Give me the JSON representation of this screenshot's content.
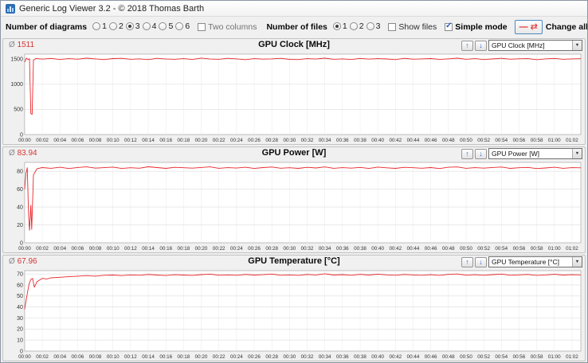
{
  "window": {
    "title": "Generic Log Viewer 3.2 - © 2018 Thomas Barth"
  },
  "icons": {
    "up_arrow": "↑",
    "down_arrow": "↓",
    "swap": "⇄",
    "dash": "—",
    "combo_arrow": "▼",
    "check": "✓"
  },
  "toolbar": {
    "diagrams_label": "Number of diagrams",
    "diagram_options": [
      "1",
      "2",
      "3",
      "4",
      "5",
      "6"
    ],
    "diagrams_selected": "3",
    "two_columns_label": "Two columns",
    "two_columns_checked": false,
    "files_label": "Number of files",
    "file_options": [
      "1",
      "2",
      "3"
    ],
    "files_selected": "1",
    "show_files_label": "Show files",
    "show_files_checked": false,
    "simple_mode_label": "Simple mode",
    "simple_mode_checked": true,
    "change_all_label": "Change all"
  },
  "chart_data": [
    {
      "type": "line",
      "title": "GPU Clock [MHz]",
      "average_label": "Ø",
      "average": "1511",
      "dropdown": "GPU Clock [MHz]",
      "line_color": "#e8262a",
      "ylim": [
        0,
        1600
      ],
      "yticks": [
        0,
        500,
        1000,
        1500
      ],
      "x_step_minutes": 2,
      "xlim_minutes": [
        0,
        63
      ],
      "x_labels": [
        "00:00",
        "00:02",
        "00:04",
        "00:06",
        "00:08",
        "00:10",
        "00:12",
        "00:14",
        "00:16",
        "00:18",
        "00:20",
        "00:22",
        "00:24",
        "00:26",
        "00:28",
        "00:30",
        "00:32",
        "00:34",
        "00:36",
        "00:38",
        "00:40",
        "00:42",
        "00:44",
        "00:46",
        "00:48",
        "00:50",
        "00:52",
        "00:54",
        "00:56",
        "00:58",
        "01:00",
        "01:02"
      ],
      "points": [
        [
          0,
          1440
        ],
        [
          0.2,
          1523
        ],
        [
          0.4,
          1490
        ],
        [
          0.55,
          1510
        ],
        [
          0.7,
          420
        ],
        [
          0.85,
          400
        ],
        [
          1.0,
          1480
        ],
        [
          1.3,
          1515
        ],
        [
          2,
          1502
        ],
        [
          3,
          1516
        ],
        [
          4,
          1494
        ],
        [
          5,
          1511
        ],
        [
          6,
          1500
        ],
        [
          7,
          1521
        ],
        [
          8,
          1506
        ],
        [
          9,
          1492
        ],
        [
          10,
          1513
        ],
        [
          11,
          1517
        ],
        [
          12,
          1499
        ],
        [
          13,
          1507
        ],
        [
          14,
          1493
        ],
        [
          15,
          1518
        ],
        [
          16,
          1504
        ],
        [
          17,
          1499
        ],
        [
          18,
          1512
        ],
        [
          19,
          1494
        ],
        [
          20,
          1522
        ],
        [
          21,
          1503
        ],
        [
          22,
          1498
        ],
        [
          23,
          1517
        ],
        [
          24,
          1506
        ],
        [
          25,
          1491
        ],
        [
          26,
          1512
        ],
        [
          27,
          1501
        ],
        [
          28,
          1507
        ],
        [
          29,
          1518
        ],
        [
          30,
          1497
        ],
        [
          31,
          1493
        ],
        [
          32,
          1511
        ],
        [
          33,
          1504
        ],
        [
          34,
          1521
        ],
        [
          35,
          1499
        ],
        [
          36,
          1507
        ],
        [
          37,
          1494
        ],
        [
          38,
          1516
        ],
        [
          39,
          1501
        ],
        [
          40,
          1512
        ],
        [
          41,
          1505
        ],
        [
          42,
          1492
        ],
        [
          43,
          1517
        ],
        [
          44,
          1500
        ],
        [
          45,
          1506
        ],
        [
          46,
          1513
        ],
        [
          47,
          1495
        ],
        [
          48,
          1507
        ],
        [
          49,
          1521
        ],
        [
          50,
          1498
        ],
        [
          51,
          1511
        ],
        [
          52,
          1494
        ],
        [
          53,
          1505
        ],
        [
          54,
          1517
        ],
        [
          55,
          1500
        ],
        [
          56,
          1508
        ],
        [
          57,
          1512
        ],
        [
          58,
          1491
        ],
        [
          59,
          1506
        ],
        [
          60,
          1516
        ],
        [
          61,
          1499
        ],
        [
          62,
          1507
        ],
        [
          63,
          1510
        ]
      ]
    },
    {
      "type": "line",
      "title": "GPU Power [W]",
      "average_label": "Ø",
      "average": "83.94",
      "dropdown": "GPU Power [W]",
      "line_color": "#e8262a",
      "ylim": [
        0,
        90
      ],
      "yticks": [
        0,
        20,
        40,
        60,
        80
      ],
      "x_step_minutes": 2,
      "xlim_minutes": [
        0,
        63
      ],
      "x_labels": [
        "00:00",
        "00:02",
        "00:04",
        "00:06",
        "00:08",
        "00:10",
        "00:12",
        "00:14",
        "00:16",
        "00:18",
        "00:20",
        "00:22",
        "00:24",
        "00:26",
        "00:28",
        "00:30",
        "00:32",
        "00:34",
        "00:36",
        "00:38",
        "00:40",
        "00:42",
        "00:44",
        "00:46",
        "00:48",
        "00:50",
        "00:52",
        "00:54",
        "00:56",
        "00:58",
        "01:00",
        "01:02"
      ],
      "points": [
        [
          0,
          60
        ],
        [
          0.15,
          78
        ],
        [
          0.3,
          84
        ],
        [
          0.45,
          30
        ],
        [
          0.55,
          14
        ],
        [
          0.7,
          42
        ],
        [
          0.8,
          15
        ],
        [
          1.0,
          76
        ],
        [
          1.4,
          83
        ],
        [
          2,
          84.2
        ],
        [
          3,
          83.4
        ],
        [
          4,
          84.6
        ],
        [
          5,
          83.1
        ],
        [
          6,
          84.3
        ],
        [
          7,
          85.0
        ],
        [
          8,
          83.6
        ],
        [
          9,
          84.1
        ],
        [
          10,
          84.7
        ],
        [
          11,
          83.2
        ],
        [
          12,
          84.0
        ],
        [
          13,
          83.5
        ],
        [
          14,
          85.1
        ],
        [
          15,
          84.2
        ],
        [
          16,
          83.3
        ],
        [
          17,
          84.5
        ],
        [
          18,
          84.0
        ],
        [
          19,
          83.6
        ],
        [
          20,
          84.3
        ],
        [
          21,
          85.0
        ],
        [
          22,
          83.4
        ],
        [
          23,
          84.1
        ],
        [
          24,
          83.7
        ],
        [
          25,
          84.6
        ],
        [
          26,
          83.2
        ],
        [
          27,
          84.2
        ],
        [
          28,
          84.8
        ],
        [
          29,
          83.5
        ],
        [
          30,
          84.0
        ],
        [
          31,
          83.3
        ],
        [
          32,
          84.5
        ],
        [
          33,
          83.8
        ],
        [
          34,
          84.9
        ],
        [
          35,
          83.4
        ],
        [
          36,
          84.1
        ],
        [
          37,
          83.6
        ],
        [
          38,
          84.4
        ],
        [
          39,
          83.2
        ],
        [
          40,
          84.7
        ],
        [
          41,
          83.9
        ],
        [
          42,
          83.3
        ],
        [
          43,
          84.5
        ],
        [
          44,
          84.0
        ],
        [
          45,
          83.5
        ],
        [
          46,
          84.2
        ],
        [
          47,
          83.1
        ],
        [
          48,
          84.6
        ],
        [
          49,
          84.9
        ],
        [
          50,
          83.4
        ],
        [
          51,
          84.1
        ],
        [
          52,
          83.6
        ],
        [
          53,
          84.3
        ],
        [
          54,
          84.8
        ],
        [
          55,
          83.3
        ],
        [
          56,
          84.0
        ],
        [
          57,
          84.4
        ],
        [
          58,
          83.1
        ],
        [
          59,
          83.8
        ],
        [
          60,
          84.6
        ],
        [
          61,
          83.4
        ],
        [
          62,
          84.1
        ],
        [
          63,
          83.9
        ]
      ]
    },
    {
      "type": "line",
      "title": "GPU Temperature [°C]",
      "average_label": "Ø",
      "average": "67.96",
      "dropdown": "GPU Temperature [°C]",
      "line_color": "#e8262a",
      "ylim": [
        0,
        73
      ],
      "yticks": [
        0,
        10,
        20,
        30,
        40,
        50,
        60,
        70
      ],
      "x_step_minutes": 2,
      "xlim_minutes": [
        0,
        63
      ],
      "x_labels": [
        "00:00",
        "00:02",
        "00:04",
        "00:06",
        "00:08",
        "00:10",
        "00:12",
        "00:14",
        "00:16",
        "00:18",
        "00:20",
        "00:22",
        "00:24",
        "00:26",
        "00:28",
        "00:30",
        "00:32",
        "00:34",
        "00:36",
        "00:38",
        "00:40",
        "00:42",
        "00:44",
        "00:46",
        "00:48",
        "00:50",
        "00:52",
        "00:54",
        "00:56",
        "00:58",
        "01:00",
        "01:02"
      ],
      "points": [
        [
          0,
          38
        ],
        [
          0.3,
          52
        ],
        [
          0.5,
          61
        ],
        [
          0.7,
          65
        ],
        [
          0.9,
          66
        ],
        [
          1.1,
          58
        ],
        [
          1.4,
          63
        ],
        [
          2,
          66
        ],
        [
          2.5,
          65.5
        ],
        [
          3,
          66.5
        ],
        [
          4,
          67
        ],
        [
          5,
          67.5
        ],
        [
          6,
          68
        ],
        [
          7,
          68.5
        ],
        [
          8,
          68
        ],
        [
          9,
          68.8
        ],
        [
          10,
          69
        ],
        [
          11,
          68.5
        ],
        [
          12,
          69.2
        ],
        [
          13,
          68.8
        ],
        [
          14,
          69.5
        ],
        [
          15,
          69
        ],
        [
          16,
          68.6
        ],
        [
          17,
          69.3
        ],
        [
          18,
          69
        ],
        [
          19,
          68.7
        ],
        [
          20,
          69.4
        ],
        [
          21,
          69.8
        ],
        [
          22,
          68.9
        ],
        [
          23,
          69.2
        ],
        [
          24,
          68.8
        ],
        [
          25,
          69.5
        ],
        [
          26,
          69
        ],
        [
          27,
          69.3
        ],
        [
          28,
          69.9
        ],
        [
          29,
          68.8
        ],
        [
          30,
          69.2
        ],
        [
          31,
          68.7
        ],
        [
          32,
          69.5
        ],
        [
          33,
          69.1
        ],
        [
          34,
          70.2
        ],
        [
          35,
          69.0
        ],
        [
          36,
          69.4
        ],
        [
          37,
          68.8
        ],
        [
          38,
          69.6
        ],
        [
          39,
          69.0
        ],
        [
          40,
          69.8
        ],
        [
          41,
          69.2
        ],
        [
          42,
          68.8
        ],
        [
          43,
          69.5
        ],
        [
          44,
          69.1
        ],
        [
          45,
          68.8
        ],
        [
          46,
          69.3
        ],
        [
          47,
          68.7
        ],
        [
          48,
          69.6
        ],
        [
          49,
          70.0
        ],
        [
          50,
          68.9
        ],
        [
          51,
          69.3
        ],
        [
          52,
          68.8
        ],
        [
          53,
          69.4
        ],
        [
          54,
          69.9
        ],
        [
          55,
          68.8
        ],
        [
          56,
          69.2
        ],
        [
          57,
          69.5
        ],
        [
          58,
          68.7
        ],
        [
          59,
          69.1
        ],
        [
          60,
          69.7
        ],
        [
          61,
          69.0
        ],
        [
          62,
          69.3
        ],
        [
          63,
          69.2
        ]
      ]
    }
  ]
}
